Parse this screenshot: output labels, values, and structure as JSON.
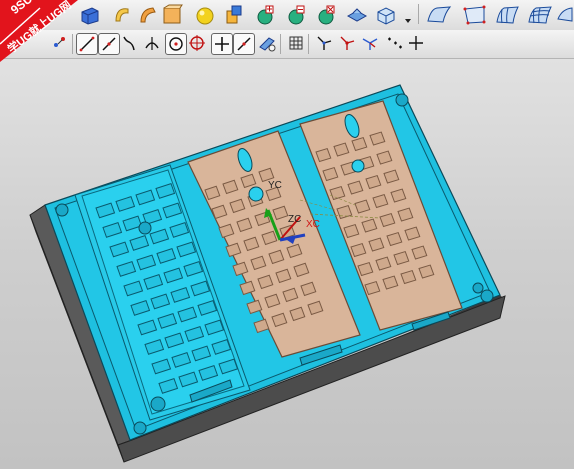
{
  "watermark": {
    "line1": "9SUG",
    "line2": "学UG就上UG网",
    "color": "#e2141c"
  },
  "toolbar_row1": [
    "block-icon",
    "revolve-icon",
    "extrude-icon",
    "swept-icon",
    "sphere-icon",
    "unite-icon",
    "subtract-icon",
    "intersect-icon",
    "delete-body-icon",
    "offset-face-icon",
    "shell-icon",
    "dropdown-arrow-icon",
    "surface-patch-icon",
    "ruled-surface-icon",
    "through-curves-icon",
    "mesh-surface-icon"
  ],
  "toolbar_row2": [
    "point-icon",
    "transform-icon",
    "line-icon",
    "arc-icon",
    "spline-icon",
    "fillet-curve-icon",
    "point-on-curve-icon",
    "target-icon",
    "crosshair-icon",
    "plus-icon",
    "slash-icon",
    "snap-icon",
    "grid-icon",
    "csys-icon",
    "csys-dynamic-icon",
    "wcs-icon",
    "point-set-icon",
    "cross-icon"
  ],
  "view_triad": {
    "xc": "XC",
    "yc": "YC",
    "zc": "ZC"
  },
  "colors": {
    "mold_base": "#1ec0e0",
    "mold_side": "#4a4a4a",
    "phone_cavity": "#d9b59a",
    "background": "#c8c8c8"
  }
}
